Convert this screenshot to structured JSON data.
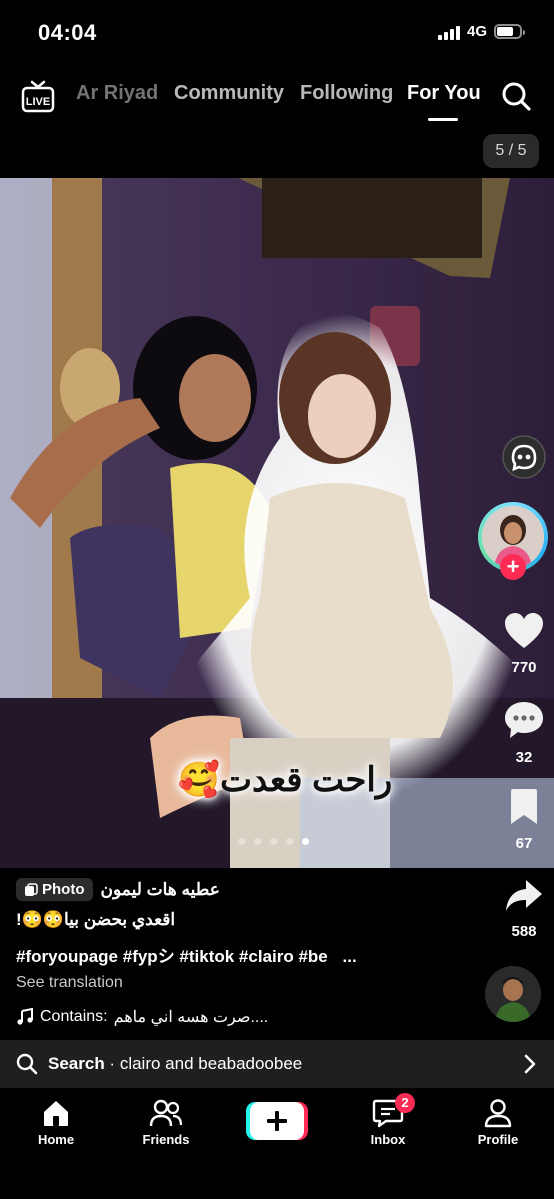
{
  "status_bar": {
    "time": "04:04",
    "network": "4G",
    "battery_fraction": 0.75
  },
  "top_nav": {
    "tabs": [
      {
        "label": "Ar Riyad"
      },
      {
        "label": "Community"
      },
      {
        "label": "Following"
      },
      {
        "label": "For You"
      }
    ],
    "active_tab": "For You"
  },
  "photo": {
    "counter": "5 / 5",
    "overlay_text": "راحت قعدت🥰",
    "slide_count": 5,
    "active_slide": 5
  },
  "actions": {
    "likes": "770",
    "comments": "32",
    "saves": "67",
    "shares": "588"
  },
  "caption": {
    "author": "عطيه هات ليمون",
    "badge_label": "Photo",
    "description": "اقعدي بحضن بيا😳😳!",
    "hashtags": "#foryoupage #fypシ #tiktok #clairo #be",
    "more": "...",
    "see_translation": "See translation",
    "sound_prefix": "Contains:",
    "sound_title": "صرت هسه اني ماهم...."
  },
  "search_bar": {
    "prefix": "Search",
    "query": "clairo and beabadoobee"
  },
  "bottom_nav": {
    "home": "Home",
    "friends": "Friends",
    "inbox": "Inbox",
    "inbox_badge": "2",
    "profile": "Profile"
  },
  "colors": {
    "accent_red": "#fe2c55",
    "accent_cyan": "#25f4ee"
  }
}
